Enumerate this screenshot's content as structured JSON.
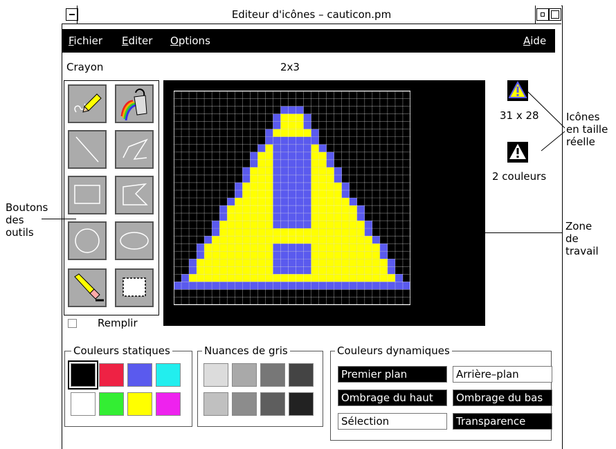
{
  "window": {
    "title": "Editeur d'icônes – cauticon.pm"
  },
  "menu": {
    "items": [
      {
        "first": "F",
        "rest": "ichier"
      },
      {
        "first": "E",
        "rest": "diter"
      },
      {
        "first": "O",
        "rest": "ptions"
      }
    ],
    "help": {
      "first": "A",
      "rest": "ide"
    }
  },
  "status": {
    "tool": "Crayon",
    "position": "2x3"
  },
  "tools": [
    {
      "name": "pencil-tool-icon"
    },
    {
      "name": "paint-bucket-tool-icon"
    },
    {
      "name": "line-tool-icon"
    },
    {
      "name": "polyline-tool-icon"
    },
    {
      "name": "rectangle-tool-icon"
    },
    {
      "name": "polygon-tool-icon"
    },
    {
      "name": "circle-tool-icon"
    },
    {
      "name": "ellipse-tool-icon"
    },
    {
      "name": "eraser-tool-icon"
    },
    {
      "name": "select-tool-icon"
    }
  ],
  "fill": {
    "label": "Remplir",
    "checked": false
  },
  "preview": {
    "size": "31 x 28",
    "colors": "2 couleurs"
  },
  "annotations": {
    "tools": [
      "Boutons",
      "des",
      "outils"
    ],
    "icons": [
      "Icônes",
      "en taille",
      "réelle"
    ],
    "work": [
      "Zone",
      "de",
      "travail"
    ]
  },
  "static_colors": {
    "label": "Couleurs statiques",
    "swatches": [
      "#000000",
      "#ee2244",
      "#5a5aee",
      "#22eeee",
      "#ffffff",
      "#33ee33",
      "#ffff00",
      "#ee22ee"
    ]
  },
  "gray_shades": {
    "label": "Nuances de gris",
    "swatches": [
      "#dcdcdc",
      "#a9a9a9",
      "#777777",
      "#444444",
      "#c0c0c0",
      "#8c8c8c",
      "#5e5e5e",
      "#222222"
    ]
  },
  "dynamic_colors": {
    "label": "Couleurs dynamiques",
    "items": [
      {
        "label": "Premier plan",
        "dark": true
      },
      {
        "label": "Arrière–plan",
        "dark": false
      },
      {
        "label": "Ombrage du haut",
        "dark": true
      },
      {
        "label": "Ombrage du bas",
        "dark": true
      },
      {
        "label": "Sélection",
        "dark": false
      },
      {
        "label": "Transparence",
        "dark": true
      }
    ]
  },
  "colors": {
    "icon_fill": "#ffff00",
    "icon_border": "#5a5aee",
    "grid": "#ffffff",
    "canvas_bg": "#000000"
  }
}
